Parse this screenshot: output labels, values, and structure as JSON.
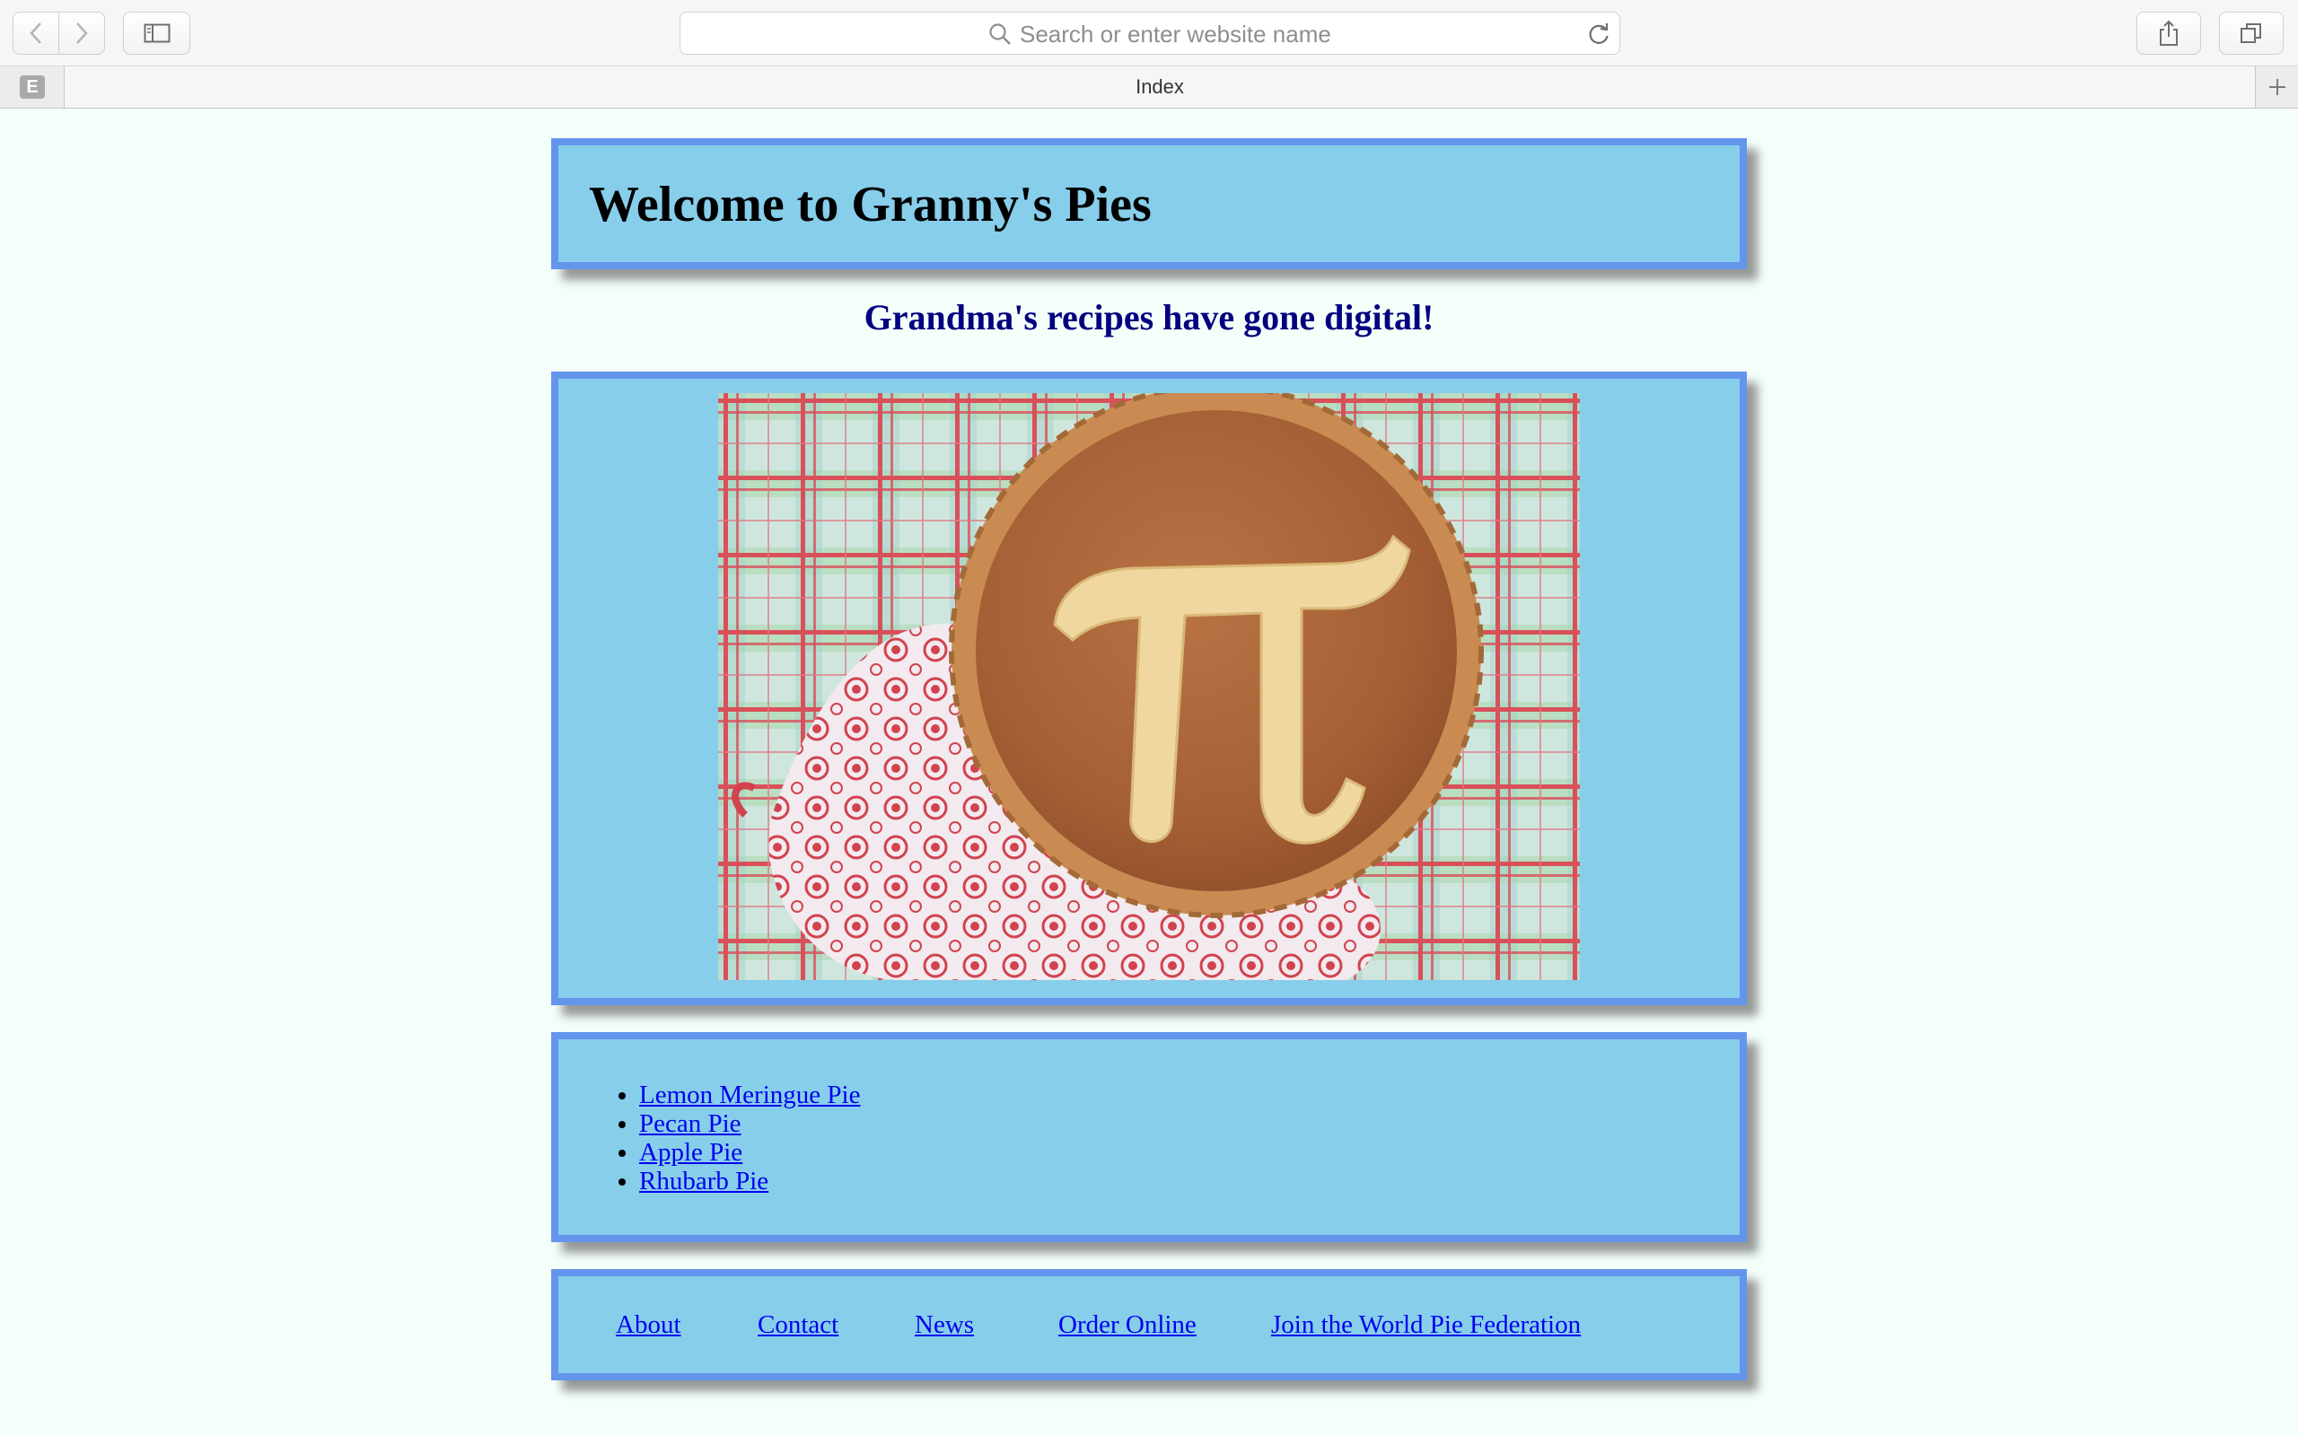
{
  "browser": {
    "address_placeholder": "Search or enter website name",
    "tab_title": "Index",
    "favicon_letter": "E"
  },
  "page": {
    "title": "Welcome to Granny's Pies",
    "tagline": "Grandma's recipes have gone digital!",
    "hero_image": "pie-with-pi-symbol",
    "recipes": [
      "Lemon Meringue Pie",
      "Pecan Pie",
      "Apple Pie",
      "Rhubarb Pie"
    ],
    "footer_links": [
      "About",
      "Contact",
      "News",
      "Order Online",
      "Join the World Pie Federation"
    ]
  },
  "colors": {
    "page_background": "#f5fffa",
    "box_background": "#87ceeb",
    "box_border": "#6495ed",
    "tagline": "#000080",
    "link": "#0000ee"
  }
}
